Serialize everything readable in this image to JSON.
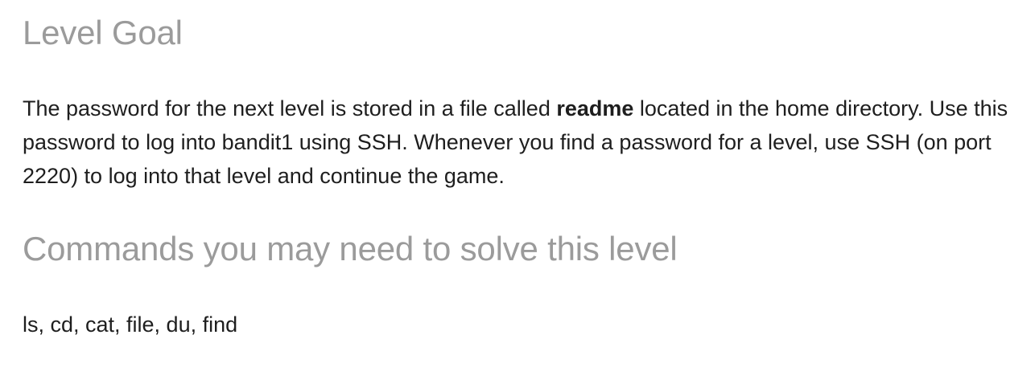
{
  "level_goal": {
    "heading": "Level Goal",
    "text_before": "The password for the next level is stored in a file called ",
    "highlight": "readme",
    "text_after": " located in the home directory. Use this password to log into bandit1 using SSH. Whenever you find a password for a level, use SSH (on port 2220) to log into that level and continue the game."
  },
  "commands": {
    "heading": "Commands you may need to solve this level",
    "list": "ls, cd, cat, file, du, find"
  },
  "colors": {
    "heading": "#9b9b9b",
    "body_text": "#1e1e1e",
    "background": "#ffffff"
  }
}
